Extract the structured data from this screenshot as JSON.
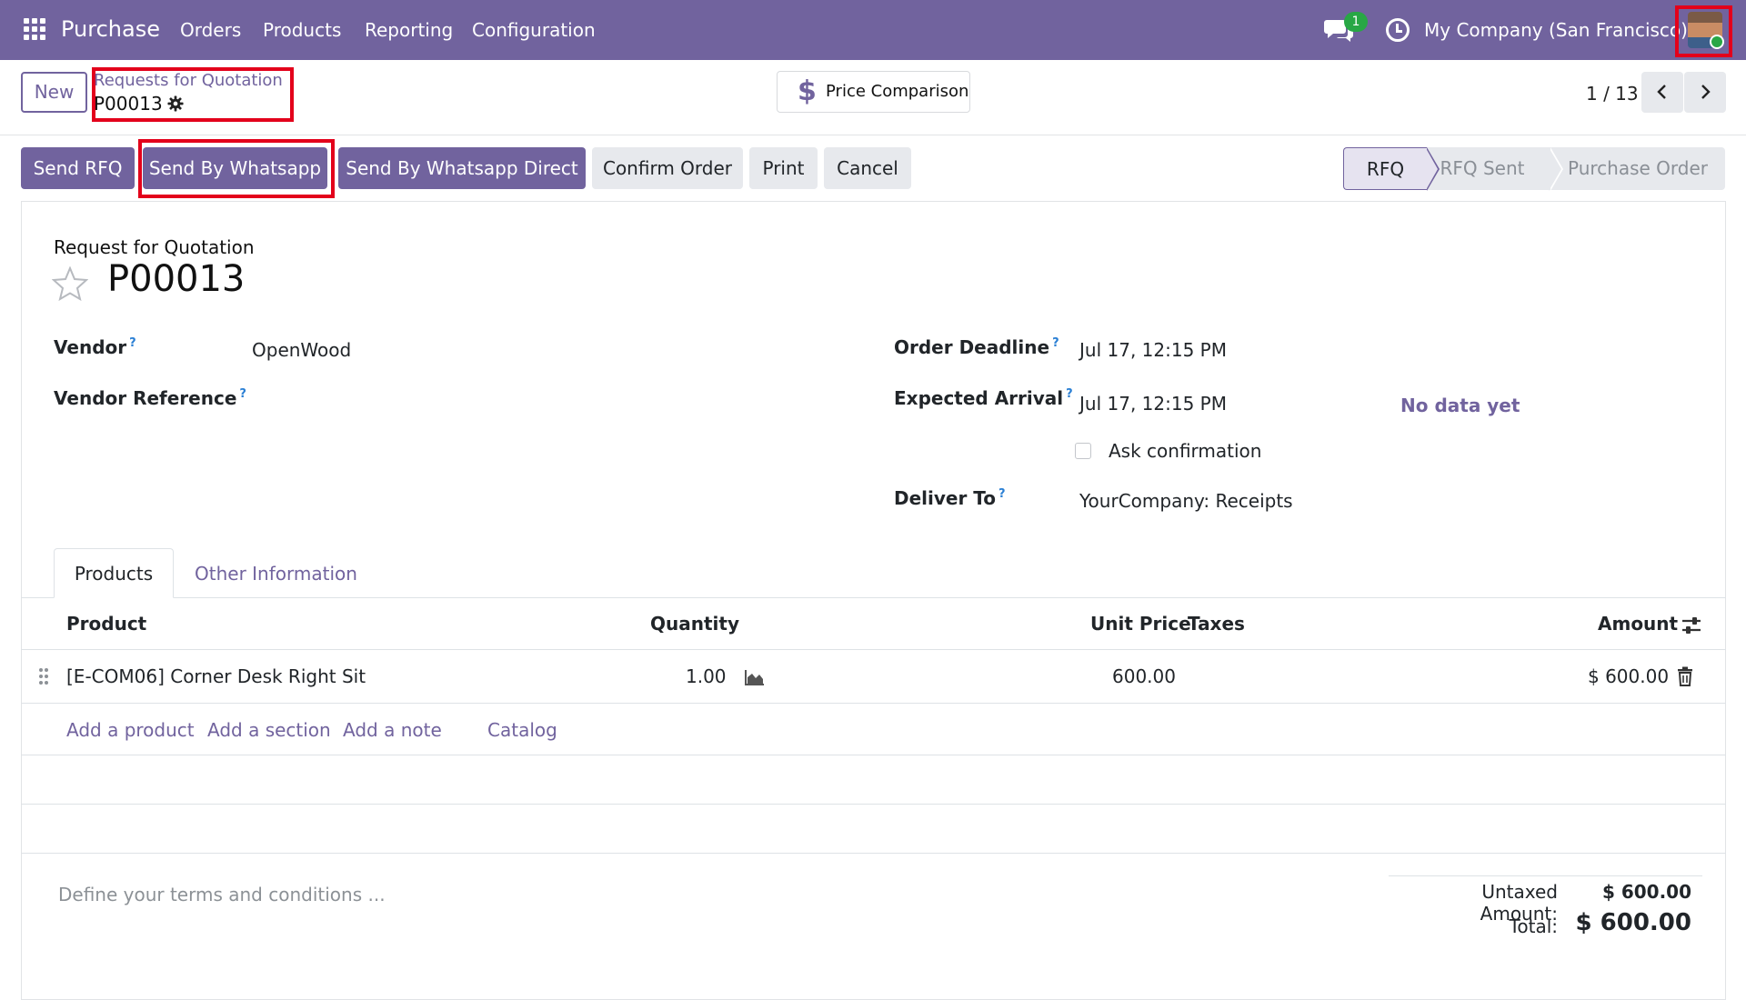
{
  "navbar": {
    "app_name": "Purchase",
    "menu": [
      "Orders",
      "Products",
      "Reporting",
      "Configuration"
    ],
    "chat_badge": "1",
    "company": "My Company (San Francisco)"
  },
  "control_panel": {
    "new_label": "New",
    "breadcrumb_parent": "Requests for Quotation",
    "breadcrumb_current": "P00013",
    "price_comparison_label": "Price Comparison",
    "pager": "1 / 13"
  },
  "actions": {
    "send_rfq": "Send RFQ",
    "send_whatsapp": "Send By Whatsapp",
    "send_whatsapp_direct": "Send By Whatsapp Direct",
    "confirm_order": "Confirm Order",
    "print": "Print",
    "cancel": "Cancel"
  },
  "statusbar": {
    "steps": [
      "RFQ",
      "RFQ Sent",
      "Purchase Order"
    ],
    "active": "RFQ"
  },
  "form": {
    "title_label": "Request for Quotation",
    "name": "P00013",
    "vendor_label": "Vendor",
    "vendor_value": "OpenWood",
    "vendor_ref_label": "Vendor Reference",
    "order_deadline_label": "Order Deadline",
    "order_deadline_value": "Jul 17, 12:15 PM",
    "expected_arrival_label": "Expected Arrival",
    "expected_arrival_value": "Jul 17, 12:15 PM",
    "no_data": "No data yet",
    "ask_confirmation_label": "Ask confirmation",
    "ask_confirmation_checked": false,
    "deliver_to_label": "Deliver To",
    "deliver_to_value": "YourCompany: Receipts",
    "help_mark": "?"
  },
  "tabs": {
    "products": "Products",
    "other": "Other Information"
  },
  "table": {
    "headers": {
      "product": "Product",
      "quantity": "Quantity",
      "unit_price": "Unit Price",
      "taxes": "Taxes",
      "amount": "Amount"
    },
    "rows": [
      {
        "product": "[E-COM06] Corner Desk Right Sit",
        "quantity": "1.00",
        "unit_price": "600.00",
        "taxes": "",
        "amount": "$ 600.00"
      }
    ],
    "add_product": "Add a product",
    "add_section": "Add a section",
    "add_note": "Add a note",
    "catalog": "Catalog"
  },
  "footer": {
    "terms_placeholder": "Define your terms and conditions ...",
    "untaxed_label": "Untaxed Amount:",
    "untaxed_value": "$ 600.00",
    "total_label": "Total:",
    "total_value": "$ 600.00"
  },
  "colors": {
    "brand": "#71639e",
    "highlight_box": "#e3001b",
    "badge": "#28a745"
  }
}
